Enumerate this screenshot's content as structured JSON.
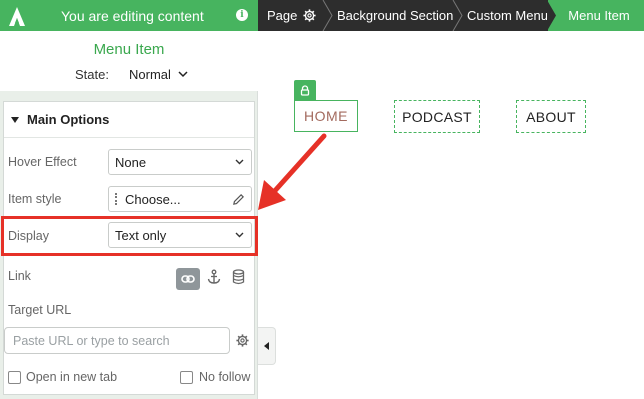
{
  "topbar": {
    "editing_text": "You are editing content",
    "breadcrumbs": [
      "Page",
      "Background Section",
      "Custom Menu"
    ],
    "active_crumb": "Menu Item",
    "accent": "#47b45f",
    "dark": "#2d2d2d"
  },
  "sidebar": {
    "title": "Menu Item",
    "state_label": "State:",
    "state_value": "Normal",
    "panel_title": "Main Options",
    "hover_effect": {
      "label": "Hover Effect",
      "value": "None"
    },
    "item_style": {
      "label": "Item style",
      "value": "Choose..."
    },
    "display": {
      "label": "Display",
      "value": "Text only"
    },
    "link": {
      "label": "Link",
      "icons": [
        "link-icon",
        "anchor-icon",
        "database-icon"
      ]
    },
    "target_url": {
      "label": "Target URL",
      "placeholder": "Paste URL or type to search"
    },
    "open_new_tab": "Open in new tab",
    "no_follow": "No follow"
  },
  "canvas": {
    "menu_items": [
      "HOME",
      "PODCAST",
      "ABOUT"
    ],
    "annotation_color": "#e63127"
  }
}
